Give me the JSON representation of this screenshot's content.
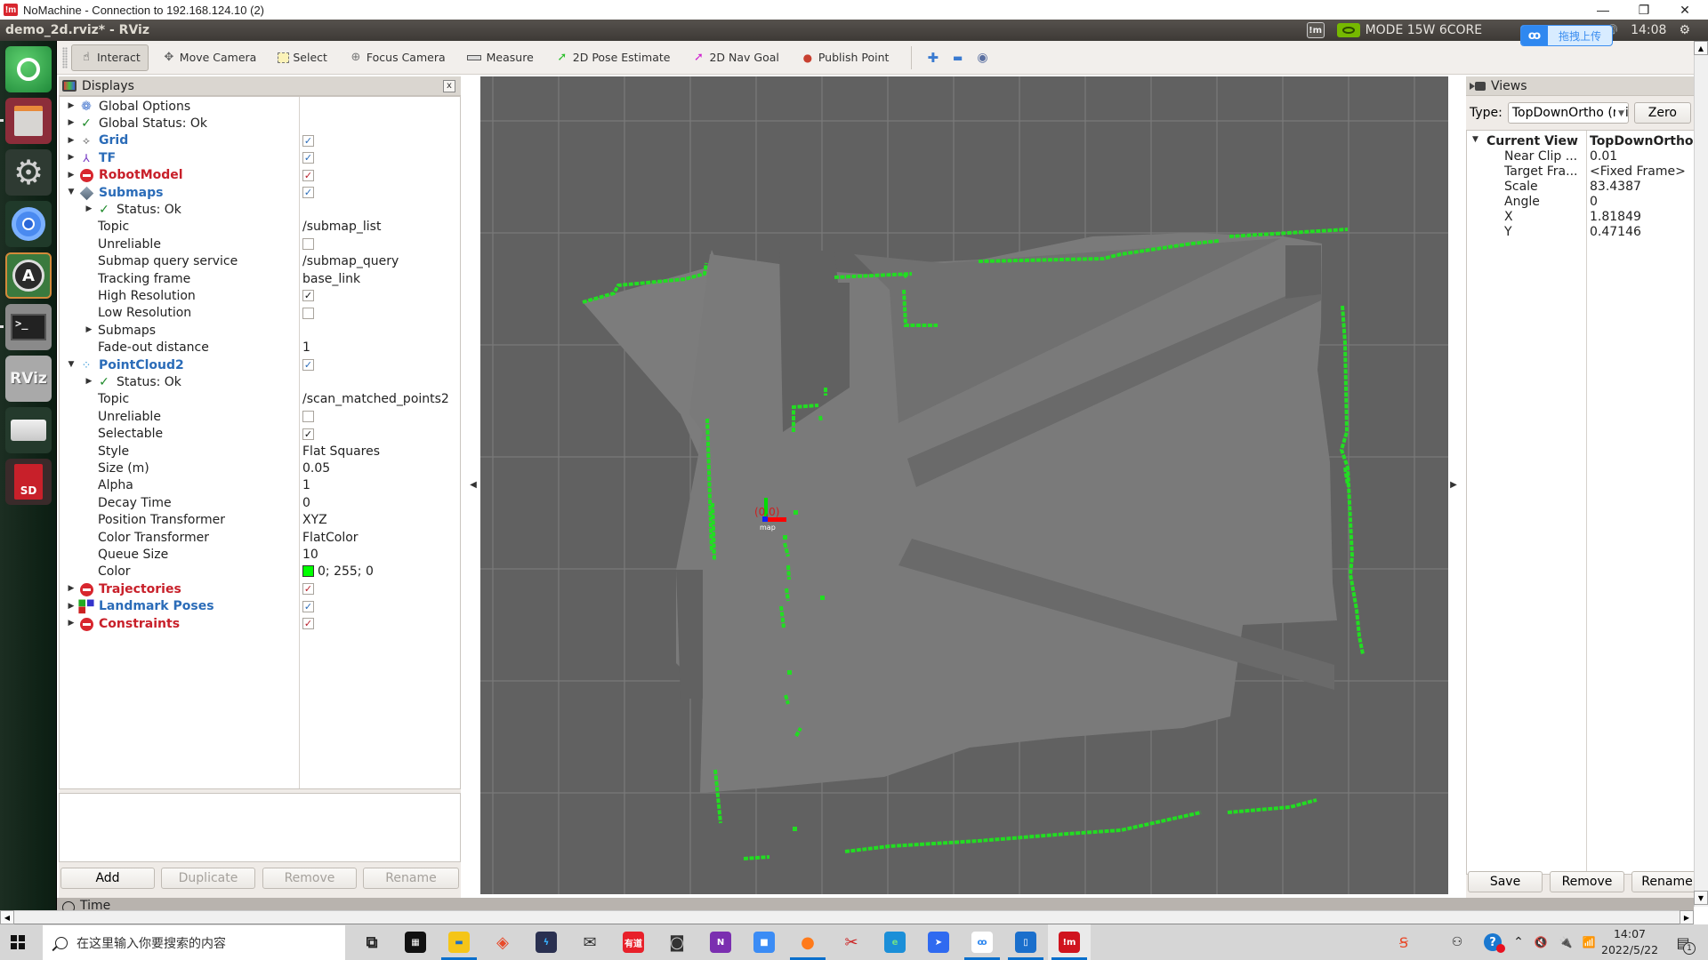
{
  "nomachine": {
    "title": "NoMachine - Connection to 192.168.124.10 (2)",
    "logo": "!m",
    "minimize": "—",
    "restore": "❐",
    "close": "✕"
  },
  "ubuntu_panel": {
    "window_title": "demo_2d.rviz* - RViz",
    "nvidia_mode": "MODE 15W 6CORE",
    "nm_indicator": "!m",
    "volume_icon": "🔊",
    "time": "14:08",
    "upload_popup": {
      "icon": "ꝏ",
      "label": "拖拽上传"
    }
  },
  "launcher": {
    "items": [
      {
        "name": "ubuntu-home",
        "label": "",
        "color": "#2f9a45"
      },
      {
        "name": "file-cabinet",
        "label": "",
        "color": "#8a2a36"
      },
      {
        "name": "system-settings",
        "label": "",
        "color": "#3c3c3c"
      },
      {
        "name": "chromium",
        "label": "",
        "color": "#2a4a34"
      },
      {
        "name": "software-updater",
        "label": "A",
        "color": "#3a7a3e"
      },
      {
        "name": "terminal",
        "label": ">_",
        "color": "#505050"
      },
      {
        "name": "rviz",
        "label": "RViz",
        "color": "#a8a8a8"
      },
      {
        "name": "drive",
        "label": "",
        "color": "#2a4030"
      },
      {
        "name": "sd-card",
        "label": "SD",
        "color": "#3a2a2a"
      }
    ]
  },
  "toolbar": {
    "tools": [
      {
        "id": "interact",
        "label": "Interact",
        "icon": "☝",
        "active": true
      },
      {
        "id": "move-camera",
        "label": "Move Camera",
        "icon": "✥",
        "active": false
      },
      {
        "id": "select",
        "label": "Select",
        "icon": "⬚",
        "active": false
      },
      {
        "id": "focus-camera",
        "label": "Focus Camera",
        "icon": "⊕",
        "active": false
      },
      {
        "id": "measure",
        "label": "Measure",
        "icon": "▭",
        "active": false
      },
      {
        "id": "2d-pose-estimate",
        "label": "2D Pose Estimate",
        "icon": "➚",
        "active": false
      },
      {
        "id": "2d-nav-goal",
        "label": "2D Nav Goal",
        "icon": "➚",
        "active": false
      },
      {
        "id": "publish-point",
        "label": "Publish Point",
        "icon": "📍",
        "active": false
      }
    ],
    "add_tool": "✚",
    "remove_tool": "▬",
    "view_tool": "◉"
  },
  "displays": {
    "title": "Displays",
    "close": "x",
    "rows": [
      {
        "level": 0,
        "arrow": "right",
        "icon": "gear",
        "label": "Global Options",
        "style": "normal",
        "value": "",
        "check": null
      },
      {
        "level": 0,
        "arrow": "right",
        "icon": "check",
        "label": "Global Status: Ok",
        "style": "normal",
        "value": "",
        "check": null
      },
      {
        "level": 0,
        "arrow": "right",
        "icon": "grid",
        "label": "Grid",
        "style": "blue",
        "value": "",
        "check": "blue"
      },
      {
        "level": 0,
        "arrow": "right",
        "icon": "tf",
        "label": "TF",
        "style": "blue",
        "value": "",
        "check": "blue"
      },
      {
        "level": 0,
        "arrow": "right",
        "icon": "stop",
        "label": "RobotModel",
        "style": "red",
        "value": "",
        "check": "red"
      },
      {
        "level": 0,
        "arrow": "down",
        "icon": "diamond",
        "label": "Submaps",
        "style": "blue",
        "value": "",
        "check": "blue"
      },
      {
        "level": 1,
        "arrow": "right",
        "icon": "check",
        "label": "Status: Ok",
        "style": "normal",
        "value": "",
        "check": null
      },
      {
        "level": 1,
        "arrow": "",
        "icon": "",
        "label": "Topic",
        "style": "normal",
        "value": "/submap_list",
        "check": null
      },
      {
        "level": 1,
        "arrow": "",
        "icon": "",
        "label": "Unreliable",
        "style": "normal",
        "value": "",
        "check": "empty"
      },
      {
        "level": 1,
        "arrow": "",
        "icon": "",
        "label": "Submap query service",
        "style": "normal",
        "value": "/submap_query",
        "check": null
      },
      {
        "level": 1,
        "arrow": "",
        "icon": "",
        "label": "Tracking frame",
        "style": "normal",
        "value": "base_link",
        "check": null
      },
      {
        "level": 1,
        "arrow": "",
        "icon": "",
        "label": "High Resolution",
        "style": "normal",
        "value": "",
        "check": "black"
      },
      {
        "level": 1,
        "arrow": "",
        "icon": "",
        "label": "Low Resolution",
        "style": "normal",
        "value": "",
        "check": "empty"
      },
      {
        "level": 1,
        "arrow": "right",
        "icon": "",
        "label": "Submaps",
        "style": "normal",
        "value": "",
        "check": null
      },
      {
        "level": 1,
        "arrow": "",
        "icon": "",
        "label": "Fade-out distance",
        "style": "normal",
        "value": "1",
        "check": null
      },
      {
        "level": 0,
        "arrow": "down",
        "icon": "cloud",
        "label": "PointCloud2",
        "style": "blue",
        "value": "",
        "check": "blue"
      },
      {
        "level": 1,
        "arrow": "right",
        "icon": "check",
        "label": "Status: Ok",
        "style": "normal",
        "value": "",
        "check": null
      },
      {
        "level": 1,
        "arrow": "",
        "icon": "",
        "label": "Topic",
        "style": "normal",
        "value": "/scan_matched_points2",
        "check": null
      },
      {
        "level": 1,
        "arrow": "",
        "icon": "",
        "label": "Unreliable",
        "style": "normal",
        "value": "",
        "check": "empty"
      },
      {
        "level": 1,
        "arrow": "",
        "icon": "",
        "label": "Selectable",
        "style": "normal",
        "value": "",
        "check": "black"
      },
      {
        "level": 1,
        "arrow": "",
        "icon": "",
        "label": "Style",
        "style": "normal",
        "value": "Flat Squares",
        "check": null
      },
      {
        "level": 1,
        "arrow": "",
        "icon": "",
        "label": "Size (m)",
        "style": "normal",
        "value": "0.05",
        "check": null
      },
      {
        "level": 1,
        "arrow": "",
        "icon": "",
        "label": "Alpha",
        "style": "normal",
        "value": "1",
        "check": null
      },
      {
        "level": 1,
        "arrow": "",
        "icon": "",
        "label": "Decay Time",
        "style": "normal",
        "value": "0",
        "check": null
      },
      {
        "level": 1,
        "arrow": "",
        "icon": "",
        "label": "Position Transformer",
        "style": "normal",
        "value": "XYZ",
        "check": null
      },
      {
        "level": 1,
        "arrow": "",
        "icon": "",
        "label": "Color Transformer",
        "style": "normal",
        "value": "FlatColor",
        "check": null
      },
      {
        "level": 1,
        "arrow": "",
        "icon": "",
        "label": "Queue Size",
        "style": "normal",
        "value": "10",
        "check": null
      },
      {
        "level": 1,
        "arrow": "",
        "icon": "",
        "label": "Color",
        "style": "normal",
        "value": "0; 255; 0",
        "check": null,
        "swatch": "#00ff00"
      },
      {
        "level": 0,
        "arrow": "right",
        "icon": "stop",
        "label": "Trajectories",
        "style": "red",
        "value": "",
        "check": "red"
      },
      {
        "level": 0,
        "arrow": "right",
        "icon": "cubes",
        "label": "Landmark Poses",
        "style": "blue",
        "value": "",
        "check": "blue"
      },
      {
        "level": 0,
        "arrow": "right",
        "icon": "stop",
        "label": "Constraints",
        "style": "red",
        "value": "",
        "check": "red"
      }
    ],
    "buttons": {
      "add": "Add",
      "duplicate": "Duplicate",
      "remove": "Remove",
      "rename": "Rename"
    }
  },
  "viewport": {
    "origin_label": "(0,0)",
    "frame_label": "map",
    "background": "#616161",
    "scan_color": "#22dd22"
  },
  "views": {
    "title": "Views",
    "type_label": "Type:",
    "type_value": "TopDownOrtho (rviz)",
    "zero": "Zero",
    "rows": [
      {
        "label": "Current View",
        "value": "TopDownOrtho ...",
        "bold": true
      },
      {
        "label": "Near Clip ...",
        "value": "0.01"
      },
      {
        "label": "Target Fra...",
        "value": "<Fixed Frame>"
      },
      {
        "label": "Scale",
        "value": "83.4387"
      },
      {
        "label": "Angle",
        "value": "0"
      },
      {
        "label": "X",
        "value": "1.81849"
      },
      {
        "label": "Y",
        "value": "0.47146"
      }
    ],
    "buttons": {
      "save": "Save",
      "remove": "Remove",
      "rename": "Rename"
    }
  },
  "time_panel": {
    "label": "Time"
  },
  "taskbar": {
    "search_placeholder": "在这里输入你要搜索的内容",
    "apps": [
      {
        "name": "task-view",
        "glyph": "⧉",
        "color": "transparent",
        "fg": "#222",
        "active": false
      },
      {
        "name": "microsoft-store",
        "glyph": "▦",
        "color": "#111",
        "fg": "#fff",
        "active": false
      },
      {
        "name": "file-explorer",
        "glyph": "▬",
        "color": "#f5c518",
        "fg": "#1f6fc5",
        "active": true
      },
      {
        "name": "app-red-diamond",
        "glyph": "◈",
        "color": "transparent",
        "fg": "#e84a2a",
        "active": false
      },
      {
        "name": "app-lightning",
        "glyph": "ϟ",
        "color": "#2a3050",
        "fg": "#38b0ff",
        "active": false
      },
      {
        "name": "mail",
        "glyph": "✉",
        "color": "transparent",
        "fg": "#333",
        "active": false
      },
      {
        "name": "youdao",
        "glyph": "有道",
        "color": "#e8202a",
        "fg": "#fff",
        "active": false
      },
      {
        "name": "camera",
        "glyph": "◙",
        "color": "transparent",
        "fg": "#333",
        "active": false
      },
      {
        "name": "onenote",
        "glyph": "N",
        "color": "#7b2fb0",
        "fg": "#fff",
        "active": false
      },
      {
        "name": "zoom",
        "glyph": "■",
        "color": "#3b8cf5",
        "fg": "#fff",
        "active": false
      },
      {
        "name": "firefox",
        "glyph": "●",
        "color": "transparent",
        "fg": "#ff7a1a",
        "active": true
      },
      {
        "name": "snipping-tool",
        "glyph": "✂",
        "color": "transparent",
        "fg": "#c22",
        "active": false
      },
      {
        "name": "edge",
        "glyph": "e",
        "color": "#1b8fd8",
        "fg": "#6fe08a",
        "active": false
      },
      {
        "name": "feishu",
        "glyph": "➤",
        "color": "#2f6af0",
        "fg": "#fff",
        "active": false
      },
      {
        "name": "baidu-netdisk",
        "glyph": "ꝏ",
        "color": "#ffffff",
        "fg": "#2f88f0",
        "active": true
      },
      {
        "name": "phone-link",
        "glyph": "▯",
        "color": "#1a6fcc",
        "fg": "#fff",
        "active": true
      },
      {
        "name": "nomachine",
        "glyph": "!m",
        "color": "#d0141e",
        "fg": "#fff",
        "active": true
      }
    ],
    "tray": {
      "people": "⚇",
      "help": "?",
      "chevron": "⌃",
      "mute": "🔇",
      "battery": "🔌",
      "wifi": "📶",
      "time": "14:07",
      "date": "2022/5/22",
      "notifications": "1"
    }
  }
}
